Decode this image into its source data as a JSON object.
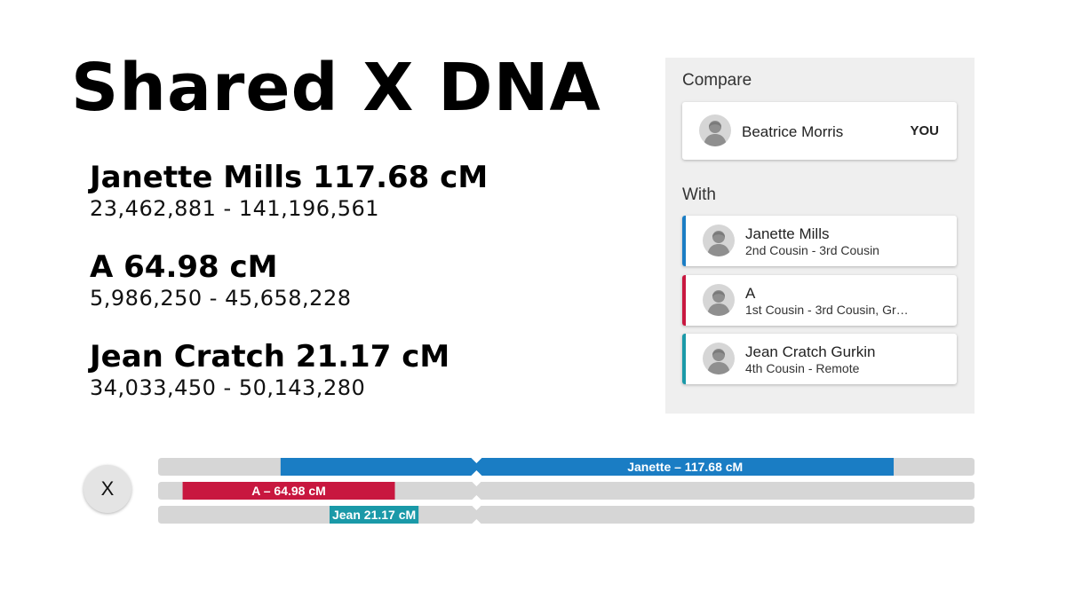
{
  "title": "Shared X DNA",
  "matches": [
    {
      "heading": "Janette Mills 117.68 cM",
      "range": "23,462,881 - 141,196,561"
    },
    {
      "heading": "A 64.98 cM",
      "range": "5,986,250 - 45,658,228"
    },
    {
      "heading": "Jean Cratch 21.17 cM",
      "range": "34,033,450 - 50,143,280"
    }
  ],
  "panel": {
    "compare_label": "Compare",
    "compare_person": {
      "name": "Beatrice Morris",
      "badge": "YOU",
      "icon": "person-avatar-icon"
    },
    "with_label": "With",
    "with_people": [
      {
        "name": "Janette Mills",
        "relationship": "2nd Cousin - 3rd Cousin",
        "color": "#1a7dc4",
        "icon": "person-avatar-icon"
      },
      {
        "name": "A",
        "relationship": "1st Cousin - 3rd Cousin, Gr…",
        "color": "#c8173f",
        "icon": "person-avatar-icon"
      },
      {
        "name": "Jean Cratch Gurkin",
        "relationship": "4th Cousin - Remote",
        "color": "#1a99a8",
        "icon": "person-avatar-icon"
      }
    ]
  },
  "chromosome": {
    "label": "X",
    "track_color": "#d6d6d6",
    "centromere_fraction": 0.39,
    "segments": [
      {
        "label": "Janette – 117.68 cM",
        "start_fraction": 0.15,
        "end_fraction": 0.901,
        "color": "#1a7dc4"
      },
      {
        "label": "A – 64.98 cM",
        "start_fraction": 0.03,
        "end_fraction": 0.29,
        "color": "#c8173f"
      },
      {
        "label": "Jean 21.17 cM",
        "start_fraction": 0.21,
        "end_fraction": 0.319,
        "color": "#1a99a8"
      }
    ]
  }
}
